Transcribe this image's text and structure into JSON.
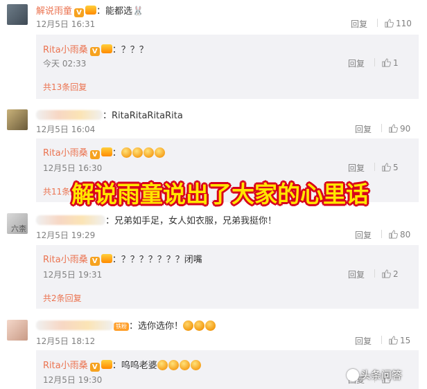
{
  "overlay_text": "解说雨童说出了大家的心里话",
  "watermark": "头条问答",
  "reply_label": "回复",
  "comments": [
    {
      "author": "解说雨童",
      "text": "：能都选",
      "time": "12月5日 16:31",
      "likes": "110",
      "reply": {
        "author": "Rita小雨桑",
        "text": "：？？？",
        "time": "今天 02:33",
        "likes": "1"
      },
      "more": "共13条回复"
    },
    {
      "author": "",
      "text": "：RitaRitaRitaRita",
      "time": "12月5日 16:04",
      "likes": "90",
      "reply": {
        "author": "Rita小雨桑",
        "text": "：",
        "time": "12月5日 16:30",
        "likes": "5"
      },
      "more": "共11条回复"
    },
    {
      "author": "",
      "avatar_text": "六柰",
      "text": "：兄弟如手足，女人如衣服，兄弟我挺你！",
      "time": "12月5日 19:29",
      "likes": "80",
      "reply": {
        "author": "Rita小雨桑",
        "text": "：？？？？？？？闭嘴",
        "time": "12月5日 19:31",
        "likes": "2"
      },
      "more": "共2条回复"
    },
    {
      "author": "",
      "badge": "铁粉",
      "text": "：选你选你！",
      "time": "12月5日 18:12",
      "likes": "15",
      "reply": {
        "author": "Rita小雨桑",
        "text": "：呜呜老婆",
        "time": "12月5日 19:30",
        "likes": ""
      }
    }
  ],
  "colors": {
    "accent": "#eb7350",
    "overlay": "#ffe600",
    "overlay_stroke": "#d8001b"
  }
}
